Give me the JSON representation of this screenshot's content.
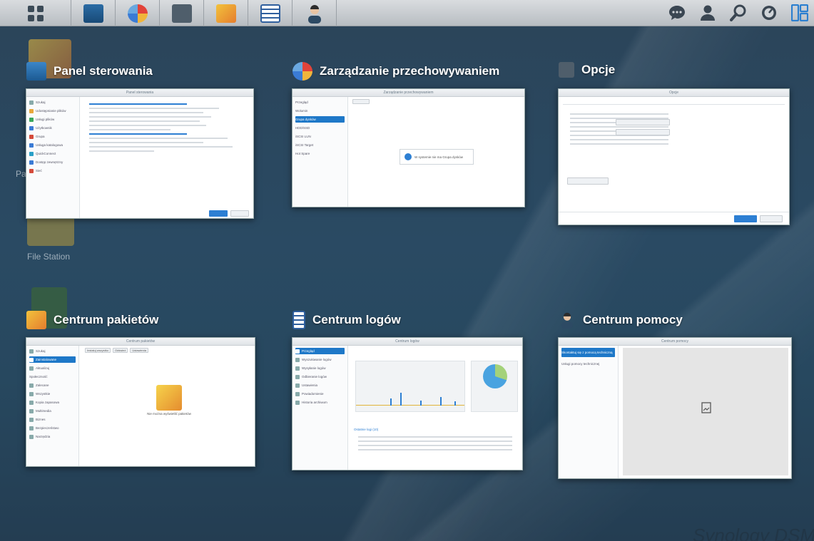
{
  "taskbar": {
    "apps": [
      {
        "icon": "panel-sterowania-icon",
        "color": "#2f6fa8"
      },
      {
        "icon": "storage-manager-icon",
        "color": "#3a6fb5"
      },
      {
        "icon": "options-gear-icon",
        "color": "#586a7a"
      },
      {
        "icon": "package-center-icon",
        "color": "#e2a83a"
      },
      {
        "icon": "log-center-icon",
        "color": "#2f5f9e"
      },
      {
        "icon": "support-center-icon",
        "color": "#37546a"
      }
    ],
    "right_icons": [
      "chat-icon",
      "user-icon",
      "search-icon",
      "resource-monitor-icon",
      "widgets-icon"
    ]
  },
  "desktop": {
    "labels": {
      "file_station": "File Station",
      "partial": "Pa"
    }
  },
  "windows": [
    {
      "title": "Panel sterowania",
      "icon": "control-panel-icon"
    },
    {
      "title": "Zarządzanie przechowywaniem",
      "icon": "storage-manager-icon"
    },
    {
      "title": "Opcje",
      "icon": "options-icon"
    },
    {
      "title": "Centrum pakietów",
      "icon": "package-center-icon"
    },
    {
      "title": "Centrum logów",
      "icon": "log-center-icon"
    },
    {
      "title": "Centrum pomocy",
      "icon": "support-center-icon"
    }
  ],
  "thumbs": {
    "panel": {
      "header": "Panel sterowania",
      "ok": "Zastosuj",
      "cancel": "Resetuj"
    },
    "storage": {
      "header": "Zarządzanie przechowywaniem",
      "items": [
        "Przegląd",
        "Wolumin",
        "Grupa dysków",
        "HDD/SSD",
        "iSCSI LUN",
        "iSCSI Target",
        "Hot Spare"
      ],
      "empty": "W systemie nie ma Grupa dysków"
    },
    "options": {
      "header": "Opcje",
      "ok": "OK",
      "cancel": "Anuluj"
    },
    "packages": {
      "header": "Centrum pakietów",
      "tabs": [
        "Instaluj wszystko",
        "Odśwież",
        "Ustawienia"
      ],
      "empty": "Nie można wyświetlić pakietów"
    },
    "logs": {
      "header": "Centrum logów",
      "section": "Ostatnie logi (10)"
    },
    "help": {
      "header": "Centrum pomocy",
      "items": [
        "Skontaktuj się z pomocą techniczną",
        "Usługi pomocy technicznej"
      ]
    }
  },
  "watermark": "Synology DSM"
}
